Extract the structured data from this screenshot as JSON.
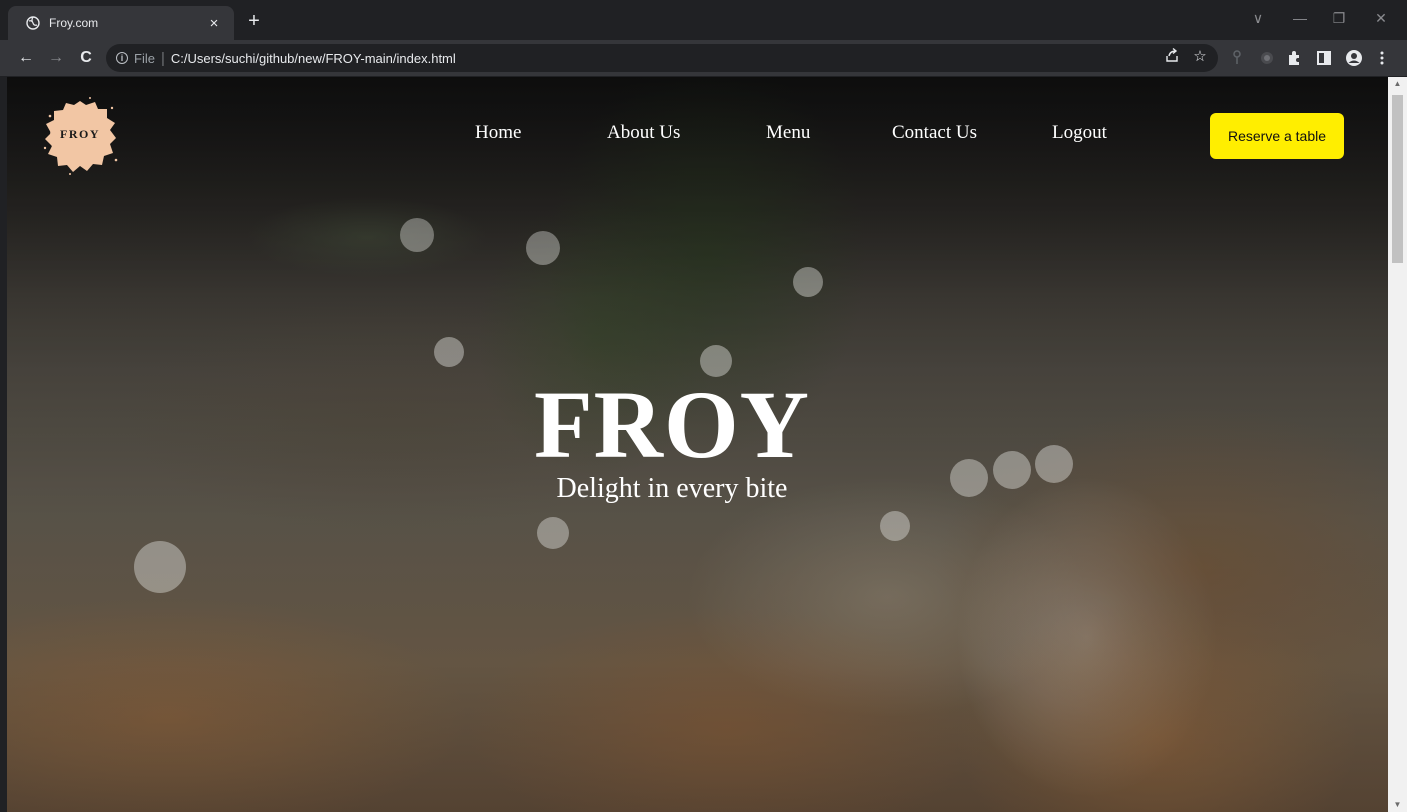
{
  "browser": {
    "tab_title": "Froy.com",
    "tab_close": "×",
    "new_tab": "+",
    "window_controls": {
      "minimize": "—",
      "restore": "❐",
      "close": "✕",
      "tab_search": "∨"
    },
    "nav": {
      "back": "←",
      "forward": "→",
      "reload": "C"
    },
    "address": {
      "scheme_label": "File",
      "separator": "|",
      "url": "C:/Users/suchi/github/new/FROY-main/index.html"
    }
  },
  "site": {
    "logo_text": "FROY",
    "logo_color": "#f2c6a4",
    "nav_items": [
      {
        "label": "Home"
      },
      {
        "label": "About Us"
      },
      {
        "label": "Menu"
      },
      {
        "label": "Contact Us"
      },
      {
        "label": "Logout"
      }
    ],
    "reserve_button": {
      "label": "Reserve a table",
      "color": "#ffee00"
    },
    "hero": {
      "title": "FROY",
      "subtitle": "Delight in every bite"
    }
  }
}
